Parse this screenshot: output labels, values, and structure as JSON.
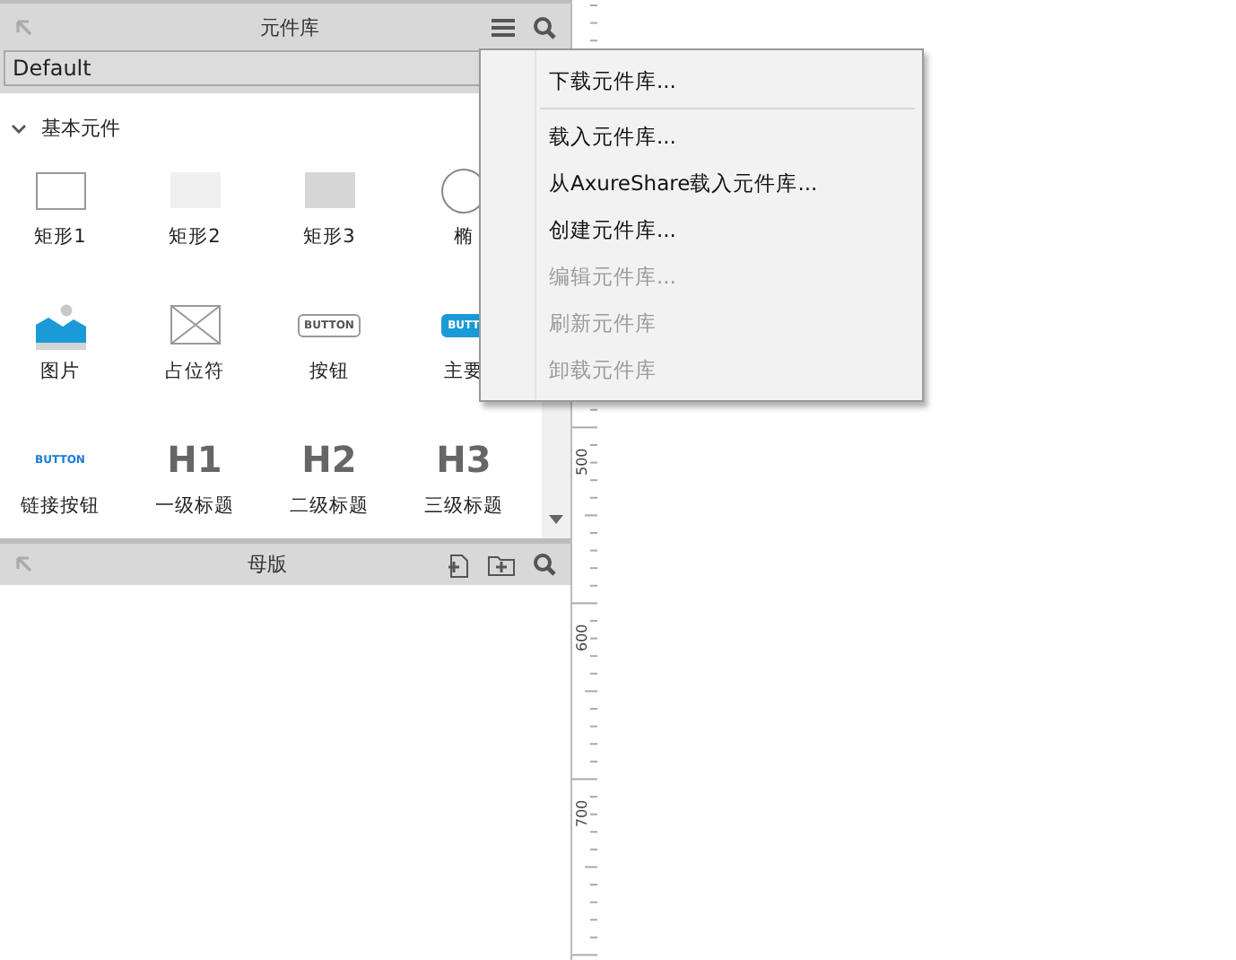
{
  "library_panel": {
    "title": "元件库",
    "library_select": {
      "value": "Default"
    },
    "group": {
      "label": "基本元件",
      "expanded": true
    },
    "widgets": [
      {
        "kind": "rect-outline",
        "label": "矩形1"
      },
      {
        "kind": "rect-light",
        "label": "矩形2"
      },
      {
        "kind": "rect-grey",
        "label": "矩形3"
      },
      {
        "kind": "ellipse",
        "label": "椭"
      },
      {
        "kind": "image",
        "label": "图片"
      },
      {
        "kind": "placeholder",
        "label": "占位符"
      },
      {
        "kind": "button",
        "label": "按钮",
        "text": "BUTTON"
      },
      {
        "kind": "primary-button",
        "label": "主要",
        "text": "BUTT"
      },
      {
        "kind": "link-button",
        "label": "链接按钮",
        "text": "BUTTON"
      },
      {
        "kind": "heading",
        "label": "一级标题",
        "text": "H1"
      },
      {
        "kind": "heading",
        "label": "二级标题",
        "text": "H2"
      },
      {
        "kind": "heading",
        "label": "三级标题",
        "text": "H3"
      }
    ]
  },
  "masters_panel": {
    "title": "母版"
  },
  "ruler": {
    "labels": [
      "500",
      "600",
      "700"
    ]
  },
  "menu": {
    "items": [
      {
        "kind": "item",
        "label": "下载元件库...",
        "disabled": false
      },
      {
        "kind": "separator"
      },
      {
        "kind": "item",
        "label": "载入元件库...",
        "disabled": false
      },
      {
        "kind": "item",
        "label": "从AxureShare载入元件库...",
        "disabled": false
      },
      {
        "kind": "item",
        "label": "创建元件库...",
        "disabled": false
      },
      {
        "kind": "item",
        "label": "编辑元件库...",
        "disabled": true
      },
      {
        "kind": "item",
        "label": "刷新元件库",
        "disabled": true
      },
      {
        "kind": "item",
        "label": "卸载元件库",
        "disabled": true
      }
    ]
  }
}
